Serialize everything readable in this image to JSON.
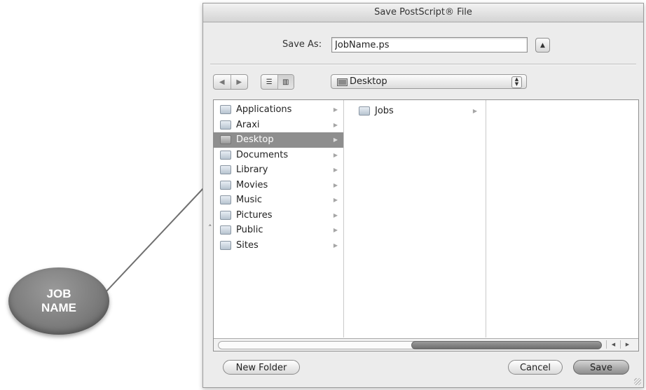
{
  "dialog": {
    "title": "Save PostScript® File",
    "save_as_label": "Save As:",
    "filename_value": "JobName.ps",
    "location": "Desktop"
  },
  "sidebar": {
    "items": [
      {
        "label": "Applications",
        "selected": false
      },
      {
        "label": "Araxi",
        "selected": false
      },
      {
        "label": "Desktop",
        "selected": true
      },
      {
        "label": "Documents",
        "selected": false
      },
      {
        "label": "Library",
        "selected": false
      },
      {
        "label": "Movies",
        "selected": false
      },
      {
        "label": "Music",
        "selected": false
      },
      {
        "label": "Pictures",
        "selected": false
      },
      {
        "label": "Public",
        "selected": false
      },
      {
        "label": "Sites",
        "selected": false
      }
    ]
  },
  "column2": {
    "items": [
      {
        "label": "Jobs"
      }
    ]
  },
  "buttons": {
    "new_folder": "New Folder",
    "cancel": "Cancel",
    "save": "Save"
  },
  "callout": {
    "line1": "JOB",
    "line2": "NAME"
  },
  "colors": {
    "selection": "#8e8e8e",
    "callout": "#7d7d7d",
    "window_bg": "#ececec"
  },
  "icons": {
    "back": "chevron-left-icon",
    "forward": "chevron-right-icon",
    "list_view": "list-view-icon",
    "column_view": "column-view-icon",
    "expand": "triangle-up-icon"
  }
}
